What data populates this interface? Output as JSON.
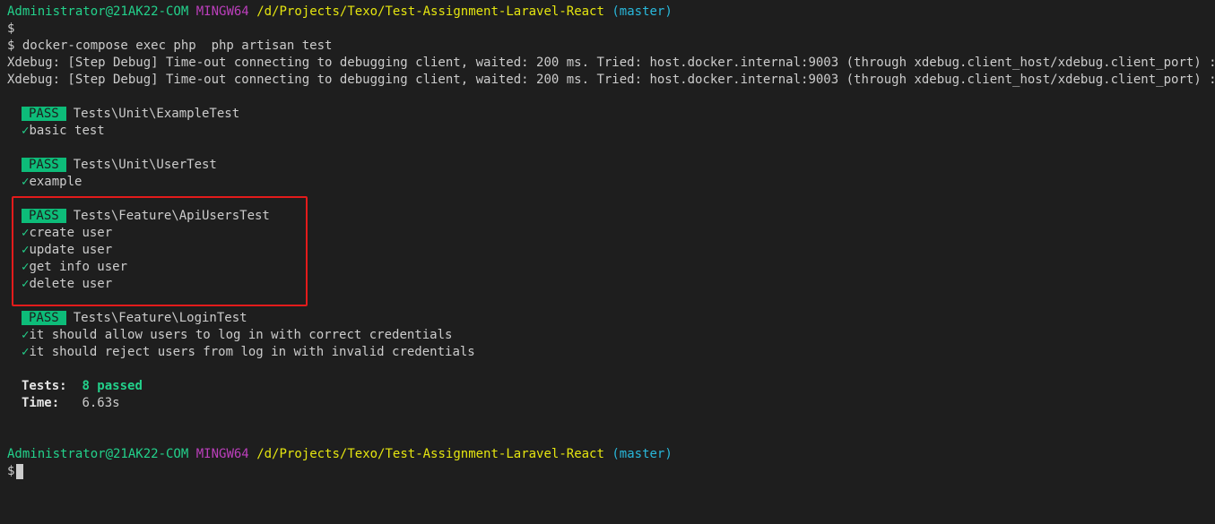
{
  "prompt1": {
    "user": "Administrator@21AK22-COM",
    "system": "MINGW64",
    "path": "/d/Projects/Texo/Test-Assignment-Laravel-React",
    "branch": "(master)",
    "symbol": "$"
  },
  "command": "$ docker-compose exec php  php artisan test",
  "xdebug_lines": [
    "Xdebug: [Step Debug] Time-out connecting to debugging client, waited: 200 ms. Tried: host.docker.internal:9003 (through xdebug.client_host/xdebug.client_port) :-(",
    "Xdebug: [Step Debug] Time-out connecting to debugging client, waited: 200 ms. Tried: host.docker.internal:9003 (through xdebug.client_host/xdebug.client_port) :-("
  ],
  "check_mark": "✓",
  "test_groups": [
    {
      "status": "PASS",
      "name": "Tests\\Unit\\ExampleTest",
      "tests": [
        "basic test"
      ]
    },
    {
      "status": "PASS",
      "name": "Tests\\Unit\\UserTest",
      "tests": [
        "example"
      ]
    },
    {
      "status": "PASS",
      "name": "Tests\\Feature\\ApiUsersTest",
      "tests": [
        "create user",
        "update user",
        "get info user",
        "delete user"
      ]
    },
    {
      "status": "PASS",
      "name": "Tests\\Feature\\LoginTest",
      "tests": [
        "it should allow users to log in with correct credentials",
        "it should reject users from log in with invalid credentials"
      ]
    }
  ],
  "summary": {
    "tests_label": "Tests:",
    "tests_value": "8 passed",
    "time_label": "Time:",
    "time_value": "6.63s"
  },
  "prompt2": {
    "user": "Administrator@21AK22-COM",
    "system": "MINGW64",
    "path": "/d/Projects/Texo/Test-Assignment-Laravel-React",
    "branch": "(master)",
    "symbol": "$"
  },
  "colors": {
    "background": "#1e1e1e",
    "text": "#cccccc",
    "user": "#23d18b",
    "mingw": "#bc3fbc",
    "path": "#e5e510",
    "branch": "#29b8db",
    "pass_badge": "#0dbc79",
    "highlight_box": "#e31b1b"
  }
}
